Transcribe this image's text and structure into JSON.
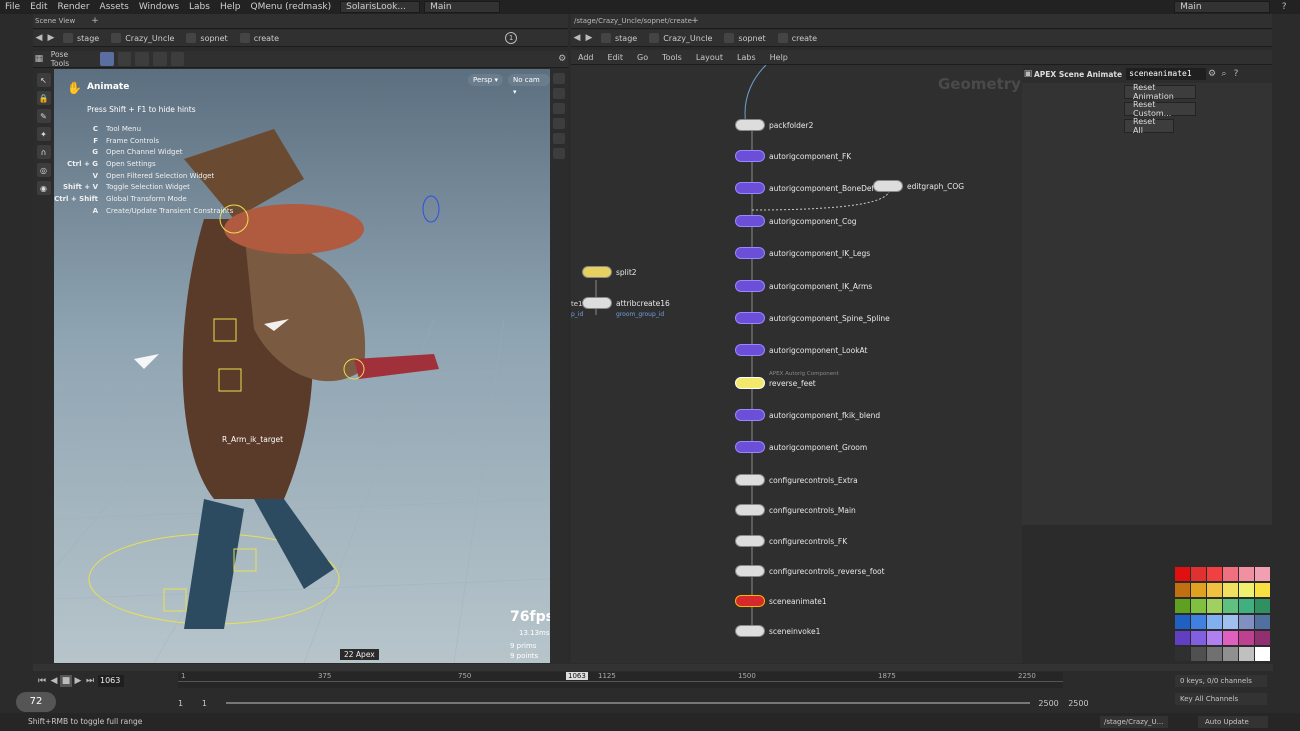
{
  "menubar": {
    "items": [
      "File",
      "Edit",
      "Render",
      "Assets",
      "Windows",
      "Labs",
      "Help",
      "QMenu (redmask)"
    ],
    "desktop": "SolarisLook...",
    "context": "Main",
    "right_context": "Main"
  },
  "left_pane": {
    "tab": "Scene View",
    "path": [
      "stage",
      "Crazy_Uncle",
      "sopnet",
      "create"
    ],
    "frame_badge": "1",
    "pose_tools": "Pose Tools",
    "persp": "Persp ▾",
    "cam": "No cam ▾",
    "animate_title": "Animate",
    "hint_line": "Press Shift + F1 to hide hints",
    "hints": [
      {
        "k": "C",
        "v": "Tool Menu"
      },
      {
        "k": "F",
        "v": "Frame Controls"
      },
      {
        "k": "G",
        "v": "Open Channel Widget"
      },
      {
        "k": "Ctrl + G",
        "v": "Open Settings"
      },
      {
        "k": "V",
        "v": "Open Filtered Selection Widget"
      },
      {
        "k": "Shift + V",
        "v": "Toggle Selection Widget"
      },
      {
        "k": "Ctrl + Shift",
        "v": "Global Transform Mode"
      },
      {
        "k": "A",
        "v": "Create/Update Transient Constraints"
      }
    ],
    "target_label": "R_Arm_ik_target",
    "fps": "76fps",
    "ms": "13.13ms",
    "prims": "9 prims",
    "points": "9 points",
    "tooltip": "22 Apex"
  },
  "right_pane": {
    "tab": "/stage/Crazy_Uncle/sopnet/create",
    "path": [
      "stage",
      "Crazy_Uncle",
      "sopnet",
      "create"
    ],
    "menu": [
      "Add",
      "Edit",
      "Go",
      "Tools",
      "Layout",
      "Labs",
      "Help"
    ],
    "watermark": "Geometry",
    "nodes": [
      {
        "name": "packfolder2",
        "t": "g"
      },
      {
        "name": "autorigcomponent_FK",
        "t": "p"
      },
      {
        "name": "autorigcomponent_BoneDeform",
        "t": "p"
      },
      {
        "name": "autorigcomponent_Cog",
        "t": "p"
      },
      {
        "name": "autorigcomponent_IK_Legs",
        "t": "p"
      },
      {
        "name": "autorigcomponent_IK_Arms",
        "t": "p"
      },
      {
        "name": "autorigcomponent_Spine_Spline",
        "t": "p"
      },
      {
        "name": "autorigcomponent_LookAt",
        "t": "p"
      },
      {
        "name": "reverse_feet",
        "t": "y"
      },
      {
        "name": "autorigcomponent_fkik_blend",
        "t": "p"
      },
      {
        "name": "autorigcomponent_Groom",
        "t": "p"
      },
      {
        "name": "configurecontrols_Extra",
        "t": "g"
      },
      {
        "name": "configurecontrols_Main",
        "t": "g"
      },
      {
        "name": "configurecontrols_FK",
        "t": "g"
      },
      {
        "name": "configurecontrols_reverse_foot",
        "t": "g"
      },
      {
        "name": "sceneanimate1",
        "t": "r"
      },
      {
        "name": "sceneinvoke1",
        "t": "g"
      }
    ],
    "side_nodes": {
      "editgraph": "editgraph_COG",
      "split": "split2",
      "attrib": "attribcreate16",
      "attrib_sub": "groom_group_id",
      "left_cut": "te1",
      "left_cut_sub": "p_id",
      "reverse_sub": "APEX Autorig Component"
    }
  },
  "parm": {
    "type": "APEX Scene Animate",
    "name": "sceneanimate1",
    "buttons": [
      "Reset Animation",
      "Reset Custom...",
      "Reset All"
    ]
  },
  "timeline": {
    "frame": "1063",
    "ticks": [
      "1",
      "375",
      "750",
      "1063",
      "1125",
      "1500",
      "1875",
      "2250"
    ],
    "start": "1",
    "start2": "1",
    "end": "2500",
    "end2": "2500",
    "keys": "0 keys, 0/0 channels",
    "key_all": "Key All Channels"
  },
  "status": {
    "message": "Shift+RMB to toggle full range",
    "path": "/stage/Crazy_U...",
    "update": "Auto Update",
    "badge": "72"
  },
  "swatches": [
    "#e01010",
    "#e03030",
    "#f04040",
    "#f07080",
    "#f090a0",
    "#f0a0b0",
    "#c07010",
    "#e0a020",
    "#f0c040",
    "#f0e060",
    "#f0f070",
    "#f8e040",
    "#60a020",
    "#80c040",
    "#a0d060",
    "#60c080",
    "#40b080",
    "#309060",
    "#2060c0",
    "#4080e0",
    "#80b0f0",
    "#a0c0f0",
    "#8090c0",
    "#5070a0",
    "#6040c0",
    "#8060e0",
    "#b080f0",
    "#e060c0",
    "#c04090",
    "#903070",
    "#303030",
    "#505050",
    "#707070",
    "#909090",
    "#c0c0c0",
    "#ffffff"
  ]
}
